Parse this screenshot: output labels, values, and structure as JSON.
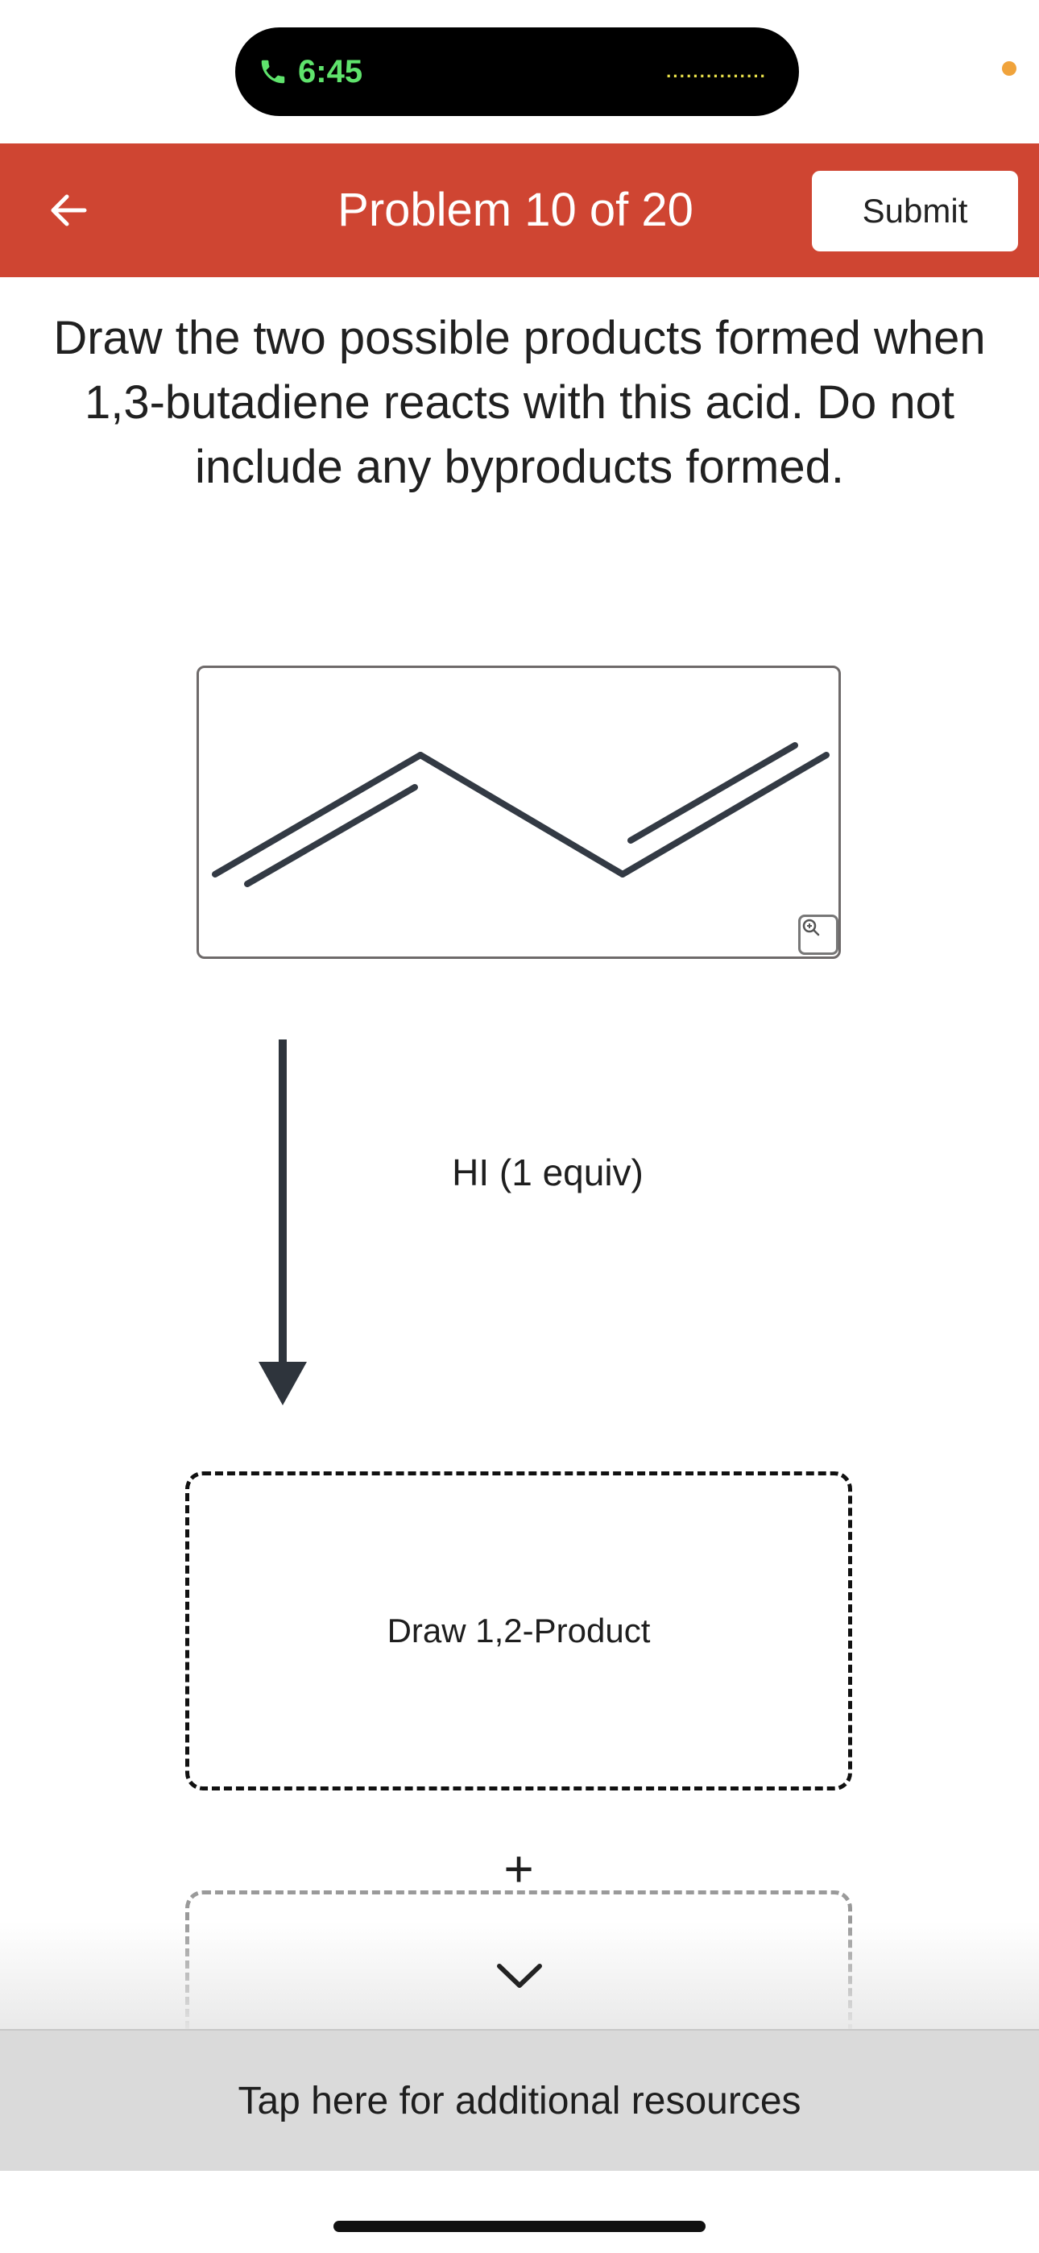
{
  "status_bar": {
    "call_time": "6:45",
    "island_dots": "···············"
  },
  "header": {
    "title": "Problem 10 of 20",
    "submit_label": "Submit",
    "back_icon": "arrow-left-icon",
    "background_color": "#cf4532"
  },
  "question": {
    "text": "Draw the two possible products formed when 1,3-butadiene reacts with this acid. Do not include any byproducts formed."
  },
  "reaction": {
    "reagent": "HI (1 equiv)",
    "zoom_icon": "zoom-in-icon"
  },
  "answers": {
    "product1_label": "Draw 1,2-Product",
    "plus": "+"
  },
  "footer": {
    "expand_icon": "chevron-down-icon",
    "resources_label": "Tap here for additional resources"
  }
}
